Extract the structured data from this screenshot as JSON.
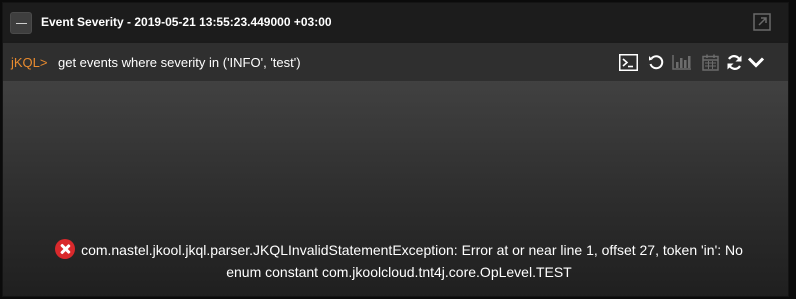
{
  "panel": {
    "title": "Event Severity - 2019-05-21 13:55:23.449000 +03:00"
  },
  "query": {
    "prompt": "jKQL>",
    "text": "get events where severity in ('INFO', 'test')"
  },
  "toolbar": {
    "icons": [
      "terminal-icon",
      "refresh-history-icon",
      "bar-chart-icon",
      "calendar-icon",
      "sync-icon",
      "chevron-down-icon"
    ]
  },
  "error": {
    "line1": "com.nastel.jkool.jkql.parser.JKQLInvalidStatementException: Error at or near line 1, offset 27, token 'in': No",
    "line2": "enum constant com.jkoolcloud.tnt4j.core.OpLevel.TEST"
  },
  "colors": {
    "prompt": "#e98b2f",
    "error_icon": "#d9292c"
  }
}
